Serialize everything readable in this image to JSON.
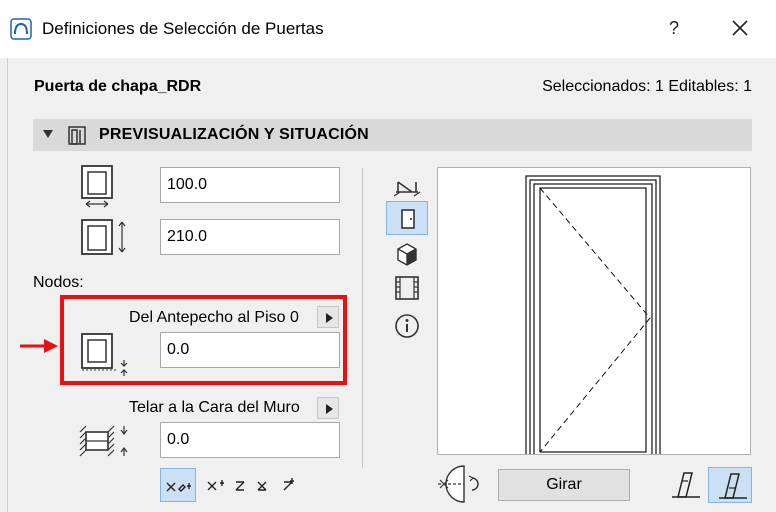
{
  "window": {
    "title": "Definiciones de Selección de Puertas",
    "help_label": "?",
    "close_label": "✕"
  },
  "header": {
    "object_name": "Puerta de chapa_RDR",
    "selection_info": "Seleccionados: 1 Editables: 1"
  },
  "section": {
    "title": "PREVISUALIZACIÓN Y SITUACIÓN"
  },
  "params": {
    "width_value": "100.0",
    "height_value": "210.0",
    "nodes_label": "Nodos:",
    "sill_label": "Del Antepecho al Piso 0",
    "sill_value": "0.0",
    "reveal_label": "Telar a la Cara del Muro",
    "reveal_value": "0.0"
  },
  "side_tools": [
    {
      "icon": "floor-plan-icon",
      "active": false
    },
    {
      "icon": "door-front-icon",
      "active": true
    },
    {
      "icon": "3d-cube-icon",
      "active": false
    },
    {
      "icon": "section-view-icon",
      "active": false
    },
    {
      "icon": "info-icon",
      "active": false
    }
  ],
  "bottom": {
    "rotate_label": "Girar"
  },
  "colors": {
    "highlight": "#e81010",
    "active_bg": "#cce0f5",
    "section_bg": "#d9d9d9"
  }
}
